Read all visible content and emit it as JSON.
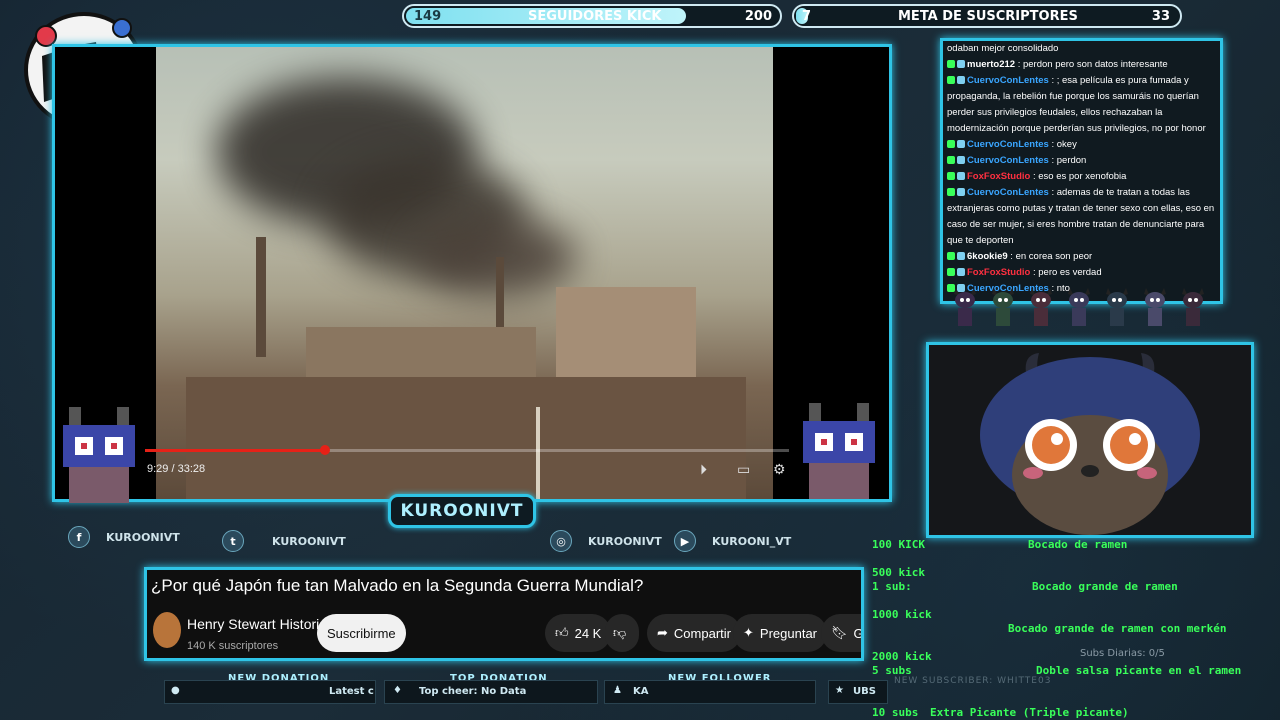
{
  "goals": {
    "kick": {
      "current": "149",
      "label": "SEGUIDORES KICK",
      "target": "200",
      "progress": 0.745
    },
    "subs": {
      "current": "7",
      "label": "META DE SUSCRIPTORES",
      "target": "33",
      "progress": 0.21
    }
  },
  "video": {
    "time": "9:29 / 33:28",
    "progress_fraction": 0.28,
    "title": "¿Por qué Japón fue tan Malvado en la Segunda Guerra Mundial?",
    "channel": "Henry Stewart Historia",
    "subscribers": "140 K suscriptores",
    "subscribe_label": "Suscribirme",
    "likes": "24 K",
    "share_label": "Compartir",
    "ask_label": "Preguntar",
    "more_label": "Gu"
  },
  "streamer": {
    "name": "KUROONIVT"
  },
  "social": {
    "facebook": "KUROONIVT",
    "twitter": "KUROONIVT",
    "instagram": "KUROONIVT",
    "youtube": "KUROONI_VT"
  },
  "alerts": {
    "new_donation": {
      "label": "NEW DONATION",
      "value": "Latest c"
    },
    "top_donation": {
      "label": "TOP DONATION",
      "value": "Top cheer: No Data"
    },
    "new_follower": {
      "label": "NEW FOLLOWER",
      "value": "KA"
    },
    "new_subscriber": {
      "label": "NEW SUBSCRIBER: WHITTE03",
      "value": "UBS"
    }
  },
  "chat": {
    "messages": [
      {
        "user": "",
        "text": "odaban mejor consolidado",
        "color": "#ffffff"
      },
      {
        "user": "muerto212",
        "text": "perdon pero son datos interesante",
        "color": "#ffffff"
      },
      {
        "user": "CuervoConLentes",
        "text": "; esa película es pura fumada y propaganda, la rebelión fue porque los samuráis no querían perder sus privilegios feudales, ellos rechazaban la modernización porque perderían sus privilegios, no por honor",
        "color": "#3aa6ff"
      },
      {
        "user": "CuervoConLentes",
        "text": "okey",
        "color": "#3aa6ff"
      },
      {
        "user": "CuervoConLentes",
        "text": "perdon",
        "color": "#3aa6ff"
      },
      {
        "user": "FoxFoxStudio",
        "text": "eso es por xenofobia",
        "color": "#ff3040"
      },
      {
        "user": "CuervoConLentes",
        "text": "ademas de te tratan a todas las extranjeras como putas y tratan de tener sexo con ellas, eso en caso de ser mujer, si eres hombre tratan de denunciarte para que te deporten",
        "color": "#3aa6ff"
      },
      {
        "user": "6kookie9",
        "text": "en corea son peor",
        "color": "#ffffff"
      },
      {
        "user": "FoxFoxStudio",
        "text": "pero es verdad",
        "color": "#ff3040"
      },
      {
        "user": "CuervoConLentes",
        "text": "nto",
        "color": "#3aa6ff"
      }
    ]
  },
  "rewards": {
    "r1_cost": "100 KICK",
    "r1_name": "Bocado de ramen",
    "r2_cost": "500 kick",
    "r2_sub": "1 sub:",
    "r2_name": "Bocado grande de ramen",
    "r3_cost": "1000 kick",
    "r3_name": "Bocado grande de ramen con merkén",
    "r4_cost": "2000 kick",
    "r4_sub": "5 subs",
    "r4_name": "Doble salsa picante en el ramen",
    "r5_cost": "10 subs",
    "r5_name": "Extra Picante (Triple picante)",
    "subs_daily": "Subs Diarias: 0/5"
  },
  "colors": {
    "accent": "#2fc4e6",
    "reward_green": "#39ff5a"
  }
}
